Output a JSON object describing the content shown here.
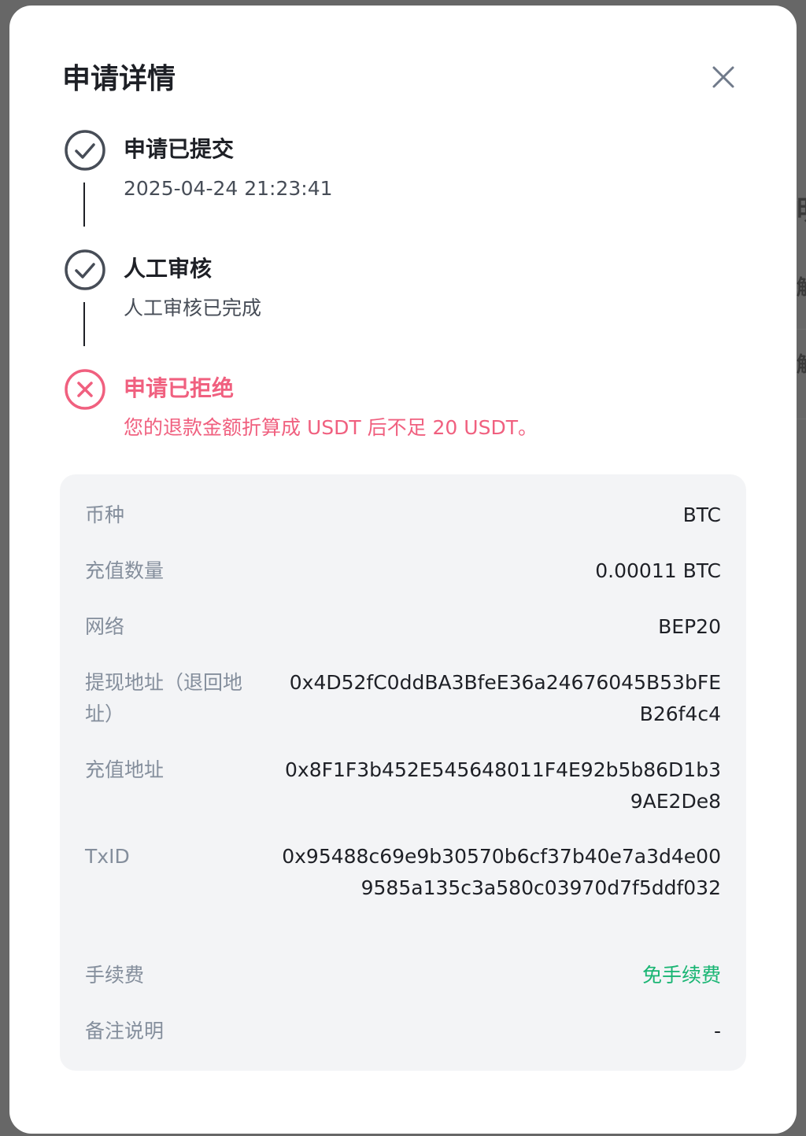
{
  "background": {
    "partial_glyphs": [
      "明",
      "解",
      "解"
    ]
  },
  "modal": {
    "title": "申请详情",
    "close_icon": "close-icon"
  },
  "steps": [
    {
      "status": "done",
      "icon": "check-circle-icon",
      "title": "申请已提交",
      "desc": "2025-04-24 21:23:41"
    },
    {
      "status": "done",
      "icon": "check-circle-icon",
      "title": "人工审核",
      "desc": "人工审核已完成"
    },
    {
      "status": "rejected",
      "icon": "x-circle-icon",
      "title": "申请已拒绝",
      "desc": "您的退款金额折算成 USDT 后不足 20 USDT。"
    }
  ],
  "details": [
    {
      "label": "币种",
      "value": "BTC"
    },
    {
      "label": "充值数量",
      "value": "0.00011 BTC"
    },
    {
      "label": "网络",
      "value": "BEP20"
    },
    {
      "label": "提现地址（退回地址）",
      "value": "0x4D52fC0ddBA3BfeE36a24676045B53bFEB26f4c4"
    },
    {
      "label": "充值地址",
      "value": "0x8F1F3b452E545648011F4E92b5b86D1b39AE2De8"
    },
    {
      "label": "TxID",
      "value": "0x95488c69e9b30570b6cf37b40e7a3d4e009585a135c3a580c03970d7f5ddf032"
    },
    {
      "label": "手续费",
      "value": "免手续费"
    },
    {
      "label": "备注说明",
      "value": "-"
    }
  ],
  "colors": {
    "text_primary": "#1e2026",
    "text_secondary": "#848e9c",
    "rejected": "#f0607f",
    "fee_green": "#19b573",
    "card_bg": "#f3f4f6"
  }
}
